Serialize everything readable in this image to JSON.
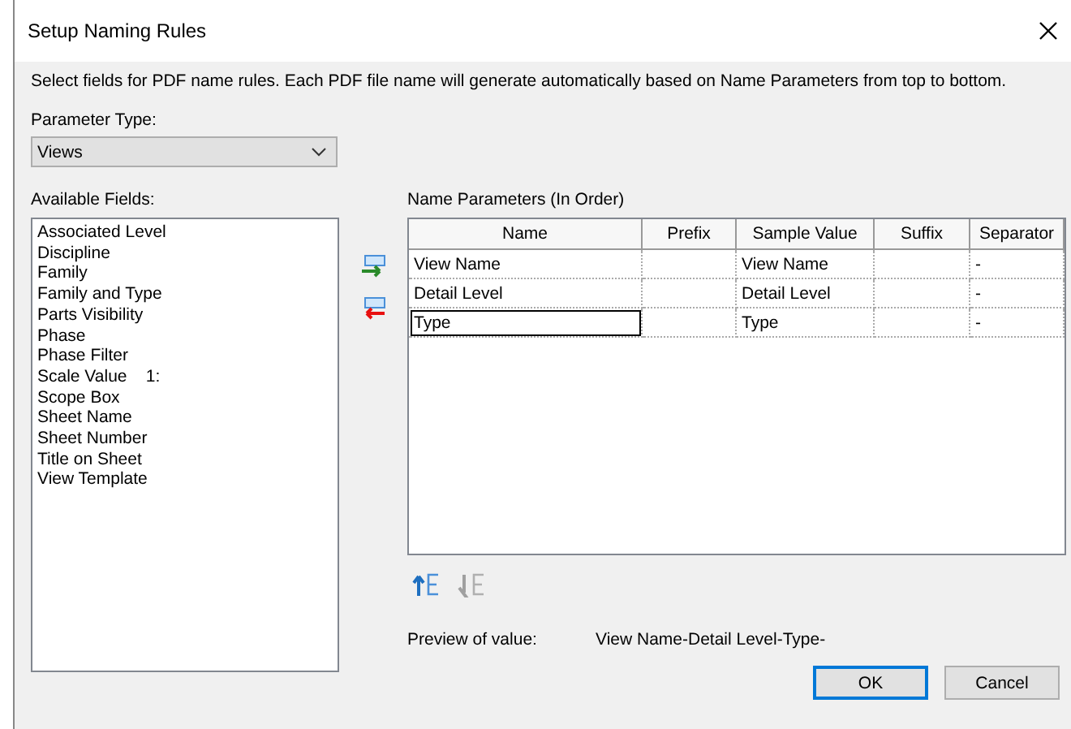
{
  "window": {
    "title": "Setup Naming Rules"
  },
  "instructions": "Select fields for PDF name rules. Each PDF file name will generate automatically based on Name Parameters from top to bottom.",
  "parameter_type": {
    "label": "Parameter Type:",
    "value": "Views"
  },
  "available_fields": {
    "label": "Available Fields:",
    "items": [
      "Associated Level",
      "Discipline",
      "Family",
      "Family and Type",
      "Parts Visibility",
      "Phase",
      "Phase Filter",
      "Scale Value    1:",
      "Scope Box",
      "Sheet Name",
      "Sheet Number",
      "Title on Sheet",
      "View Template"
    ]
  },
  "name_parameters": {
    "label": "Name Parameters (In Order)",
    "columns": [
      "Name",
      "Prefix",
      "Sample Value",
      "Suffix",
      "Separator"
    ],
    "rows": [
      {
        "cells": [
          "View Name",
          "",
          "View Name",
          "",
          "-"
        ],
        "selected": false
      },
      {
        "cells": [
          "Detail Level",
          "",
          "Detail Level",
          "",
          "-"
        ],
        "selected": false
      },
      {
        "cells": [
          "Type",
          "",
          "Type",
          "",
          "-"
        ],
        "selected": true
      }
    ]
  },
  "move_buttons": [
    {
      "kind": "up",
      "disabled": false
    },
    {
      "kind": "down",
      "disabled": true
    }
  ],
  "preview": {
    "label": "Preview of value:",
    "value": "View Name-Detail Level-Type-"
  },
  "buttons": [
    {
      "label": "OK",
      "default": true
    },
    {
      "label": "Cancel",
      "default": false
    }
  ]
}
